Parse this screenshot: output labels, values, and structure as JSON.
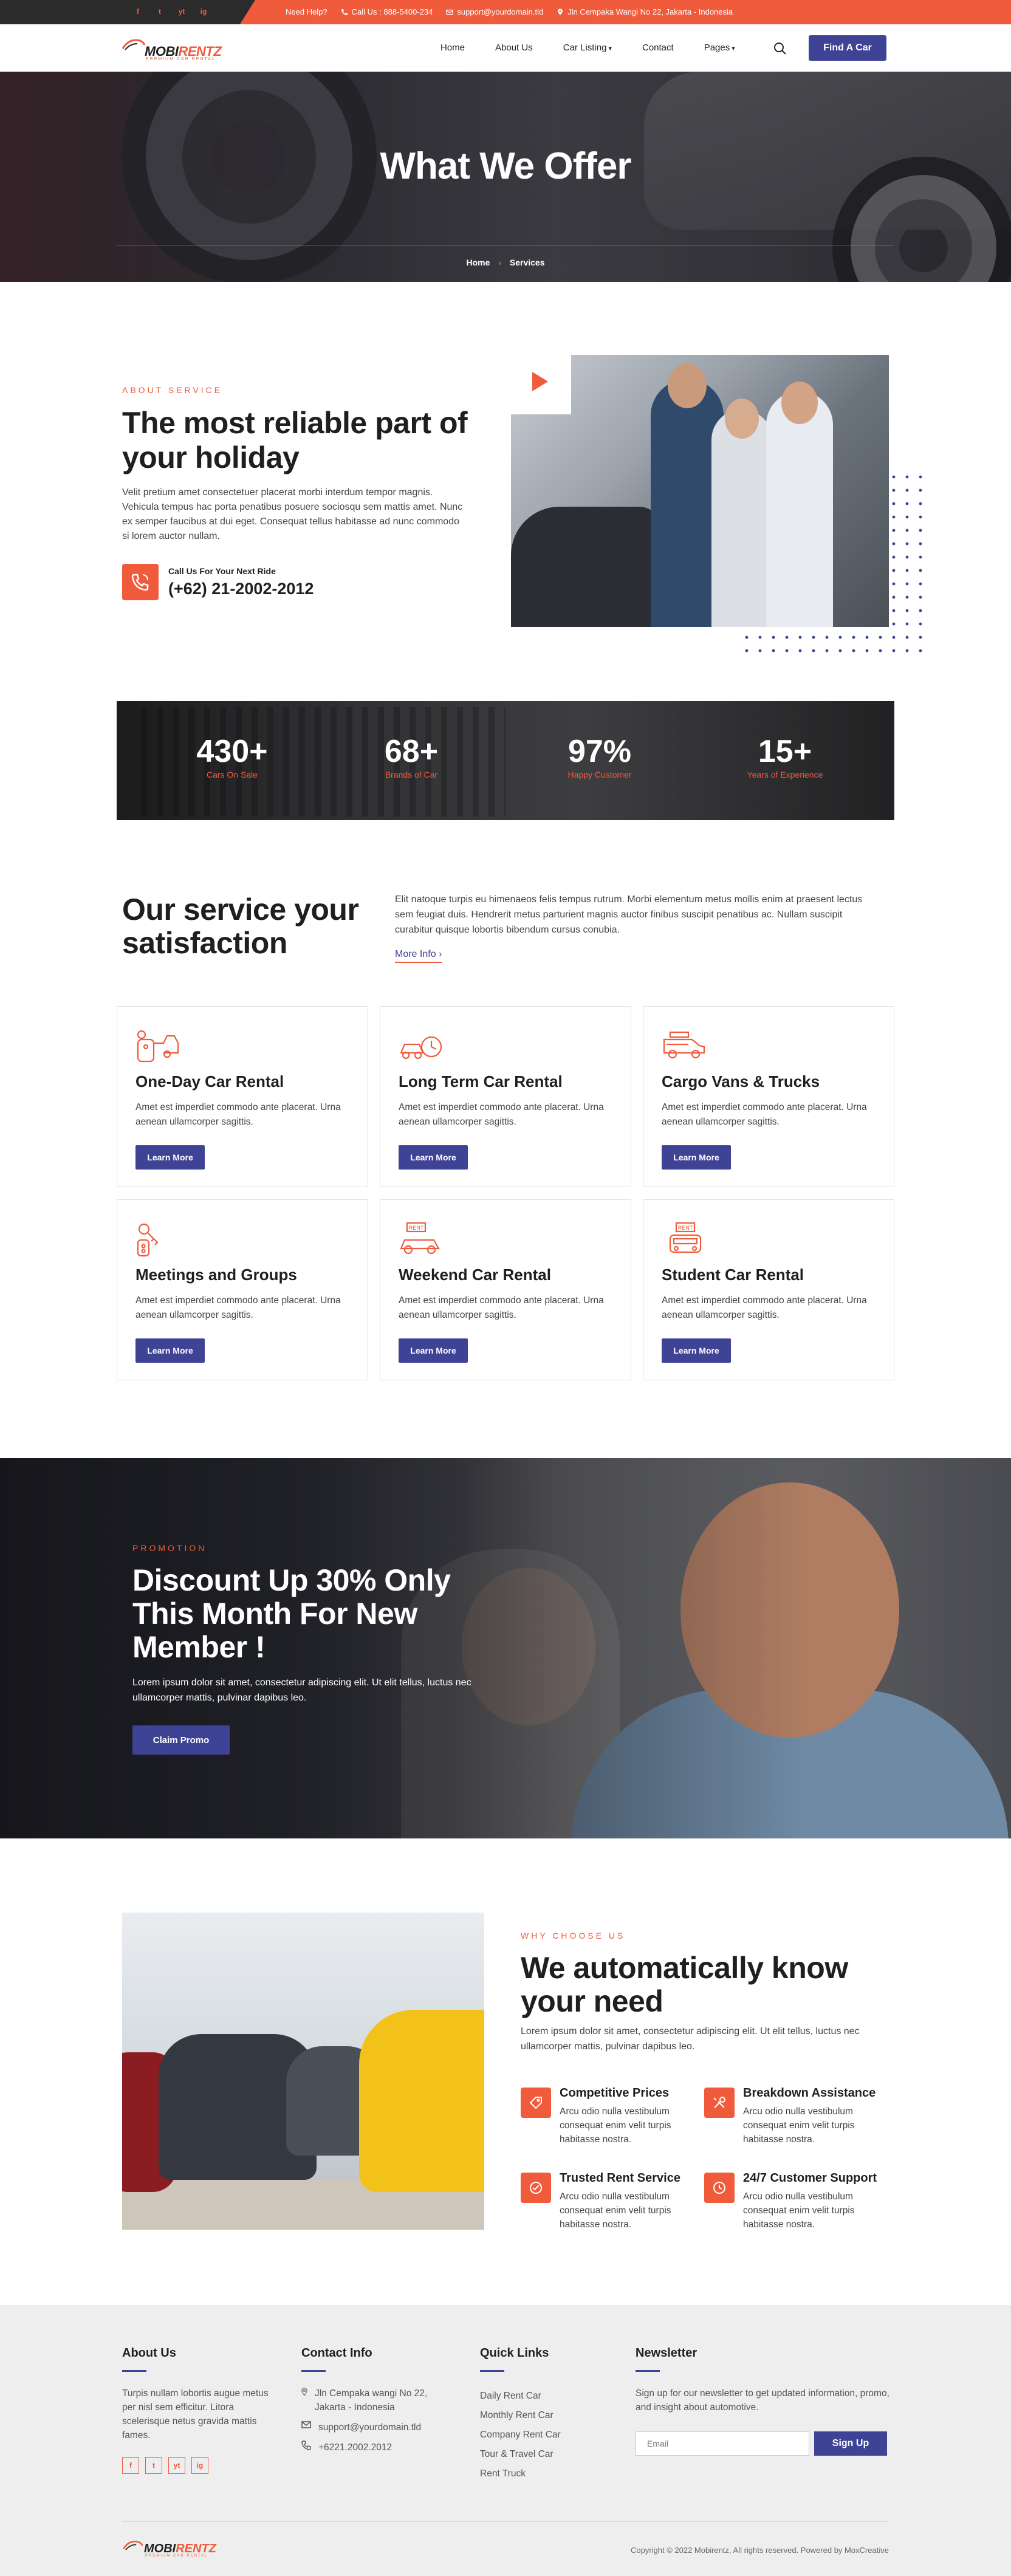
{
  "topbar": {
    "socials": [
      "f",
      "t",
      "yt",
      "ig"
    ],
    "need_help": "Need Help?",
    "call": "Call Us : 888-5400-234",
    "email": "support@yourdomain.tld",
    "address": "Jln Cempaka Wangi No 22, Jakarta - Indonesia"
  },
  "nav": {
    "logo_brand": "MOBI",
    "logo_accent": "RENTZ",
    "logo_tagline": "PREMIUM CAR RENTAL",
    "items": [
      "Home",
      "About Us",
      "Car Listing",
      "Contact",
      "Pages"
    ],
    "cta": "Find A Car"
  },
  "hero": {
    "title": "What We Offer",
    "breadcrumb_home": "Home",
    "breadcrumb_sep": "›",
    "breadcrumb_current": "Services"
  },
  "about": {
    "eyebrow": "ABOUT SERVICE",
    "title": "The most reliable part of your holiday",
    "body": "Velit pretium amet consectetuer placerat morbi interdum tempor magnis. Vehicula tempus hac porta penatibus posuere sociosqu sem mattis amet. Nunc ex semper faucibus at dui eget. Consequat tellus habitasse ad nunc commodo si lorem auctor nullam.",
    "call_label": "Call Us For Your Next Ride",
    "call_number": "(+62) 21-2002-2012"
  },
  "stats": [
    {
      "value": "430+",
      "label": "Cars On Sale"
    },
    {
      "value": "68+",
      "label": "Brands of Car"
    },
    {
      "value": "97%",
      "label": "Happy Customer"
    },
    {
      "value": "15+",
      "label": "Years of Experience"
    }
  ],
  "services": {
    "title": "Our service your satisfaction",
    "desc": "Elit natoque turpis eu himenaeos felis tempus rutrum. Morbi elementum metus mollis enim at praesent lectus sem feugiat duis. Hendrerit metus parturient magnis auctor finibus suscipit penatibus ac. Nullam suscipit curabitur quisque lobortis bibendum cursus conubia.",
    "more": "More Info",
    "cards": [
      {
        "title": "One-Day Car Rental",
        "body": "Amet est imperdiet commodo ante placerat. Urna aenean ullamcorper sagittis.",
        "btn": "Learn More",
        "icon": "car-key-icon"
      },
      {
        "title": "Long Term Car Rental",
        "body": "Amet est imperdiet commodo ante placerat. Urna aenean ullamcorper sagittis.",
        "btn": "Learn More",
        "icon": "car-clock-icon"
      },
      {
        "title": "Cargo Vans & Trucks",
        "body": "Amet est imperdiet commodo ante placerat. Urna aenean ullamcorper sagittis.",
        "btn": "Learn More",
        "icon": "van-icon"
      },
      {
        "title": "Meetings and Groups",
        "body": "Amet est imperdiet commodo ante placerat. Urna aenean ullamcorper sagittis.",
        "btn": "Learn More",
        "icon": "keys-icon"
      },
      {
        "title": "Weekend Car Rental",
        "body": "Amet est imperdiet commodo ante placerat. Urna aenean ullamcorper sagittis.",
        "btn": "Learn More",
        "icon": "rent-car-icon",
        "badge": "RENT"
      },
      {
        "title": "Student Car Rental",
        "body": "Amet est imperdiet commodo ante placerat. Urna aenean ullamcorper sagittis.",
        "btn": "Learn More",
        "icon": "rent-car-front-icon",
        "badge": "RENT"
      }
    ]
  },
  "promo": {
    "eyebrow": "PROMOTION",
    "title": "Discount Up 30% Only This Month For New Member !",
    "body": "Lorem ipsum dolor sit amet, consectetur adipiscing elit. Ut elit tellus, luctus nec ullamcorper mattis, pulvinar dapibus leo.",
    "btn": "Claim Promo"
  },
  "why": {
    "eyebrow": "WHY CHOOSE US",
    "title": "We automatically know your need",
    "lead": "Lorem ipsum dolor sit amet, consectetur adipiscing elit. Ut elit tellus, luctus nec ullamcorper mattis, pulvinar dapibus leo.",
    "features": [
      {
        "title": "Competitive Prices",
        "body": "Arcu odio nulla vestibulum consequat enim velit turpis habitasse nostra.",
        "icon": "price-tag-icon"
      },
      {
        "title": "Breakdown Assistance",
        "body": "Arcu odio nulla vestibulum consequat enim velit turpis habitasse nostra.",
        "icon": "tools-icon"
      },
      {
        "title": "Trusted Rent Service",
        "body": "Arcu odio nulla vestibulum consequat enim velit turpis habitasse nostra.",
        "icon": "handshake-icon"
      },
      {
        "title": "24/7 Customer Support",
        "body": "Arcu odio nulla vestibulum consequat enim velit turpis habitasse nostra.",
        "icon": "support-icon"
      }
    ]
  },
  "footer": {
    "about_title": "About Us",
    "about_body": "Turpis nullam lobortis augue metus per nisl sem efficitur. Litora scelerisque netus gravida mattis fames.",
    "socials": [
      "f",
      "t",
      "yt",
      "ig"
    ],
    "contact_title": "Contact Info",
    "contact_address": "Jln Cempaka wangi No 22, Jakarta - Indonesia",
    "contact_email": "support@yourdomain.tld",
    "contact_phone": "+6221.2002.2012",
    "links_title": "Quick Links",
    "links": [
      "Daily Rent Car",
      "Monthly Rent Car",
      "Company Rent Car",
      "Tour & Travel Car",
      "Rent Truck"
    ],
    "newsletter_title": "Newsletter",
    "newsletter_body": "Sign up for our newsletter to get updated information, promo, and insight about automotive.",
    "email_placeholder": "Email",
    "signup": "Sign Up",
    "copyright": "Copyright © 2022 Mobirentz, All rights reserved. Powered by MoxCreative"
  },
  "colors": {
    "accent": "#f05b3c",
    "brand": "#3f4396",
    "dark": "#1f1f1f"
  }
}
